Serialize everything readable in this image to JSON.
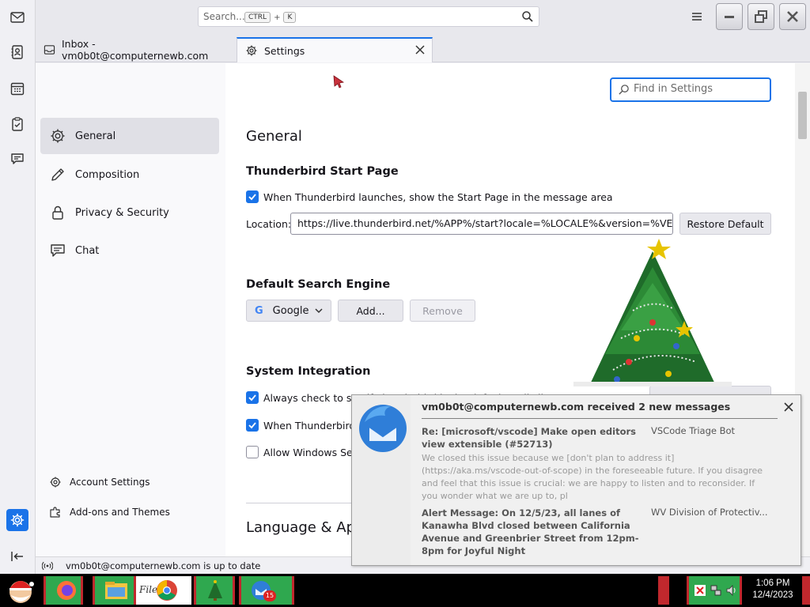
{
  "window": {
    "search_placeholder": "Search...",
    "search_kbd_ctrl": "CTRL",
    "search_kbd_plus": "+",
    "search_kbd_key": "K"
  },
  "tabs": [
    {
      "label": "Inbox - vm0b0t@computernewb.com"
    },
    {
      "label": "Settings"
    }
  ],
  "categories": {
    "general": "General",
    "composition": "Composition",
    "privacy": "Privacy & Security",
    "chat": "Chat",
    "account_settings": "Account Settings",
    "addons": "Add-ons and Themes"
  },
  "main": {
    "find_placeholder": "Find in Settings",
    "heading": "General",
    "start_page_heading": "Thunderbird Start Page",
    "start_page_checkbox": "When Thunderbird launches, show the Start Page in the message area",
    "location_label": "Location:",
    "location_value": "https://live.thunderbird.net/%APP%/start?locale=%LOCALE%&version=%VERSION%",
    "restore_default": "Restore Default",
    "search_engine_heading": "Default Search Engine",
    "search_engine_value": "Google",
    "add_button": "Add...",
    "remove_button": "Remove",
    "system_integration_heading": "System Integration",
    "check_default": "Always check to see if Thunderbird is the default mail client on startup",
    "when_thunderbird": "When Thunderbird is minimized, move it to the tray",
    "allow_windows_search": "Allow Windows Search to search messages",
    "language_heading": "Language & Appearance"
  },
  "status": {
    "text": "vm0b0t@computernewb.com is up to date"
  },
  "notification": {
    "title": "vm0b0t@computernewb.com received 2 new messages",
    "messages": [
      {
        "subject": "Re: [microsoft/vscode] Make open editors view extensible (#52713)",
        "from": "VSCode Triage Bot",
        "preview": "We closed this issue because we [don't plan to address it](https://aka.ms/vscode-out-of-scope) in the foreseeable future. If you disagree and feel that this issue is crucial: we are happy to listen and to reconsider. If you wonder what we are up to, pl"
      },
      {
        "subject": "Alert Message: On 12/5/23, all lanes of Kanawha Blvd closed between California Avenue and Greenbrier Street from 12pm-8pm for Joyful Night",
        "from": "WV Division of Protectiv..."
      }
    ]
  },
  "taskbar": {
    "files_label": "Files",
    "time": "1:06 PM",
    "date": "12/4/2023",
    "badge_count": "15"
  },
  "colors": {
    "accent": "#1a73e8",
    "taskbar": "#000000",
    "tray_red": "#c0282d"
  }
}
